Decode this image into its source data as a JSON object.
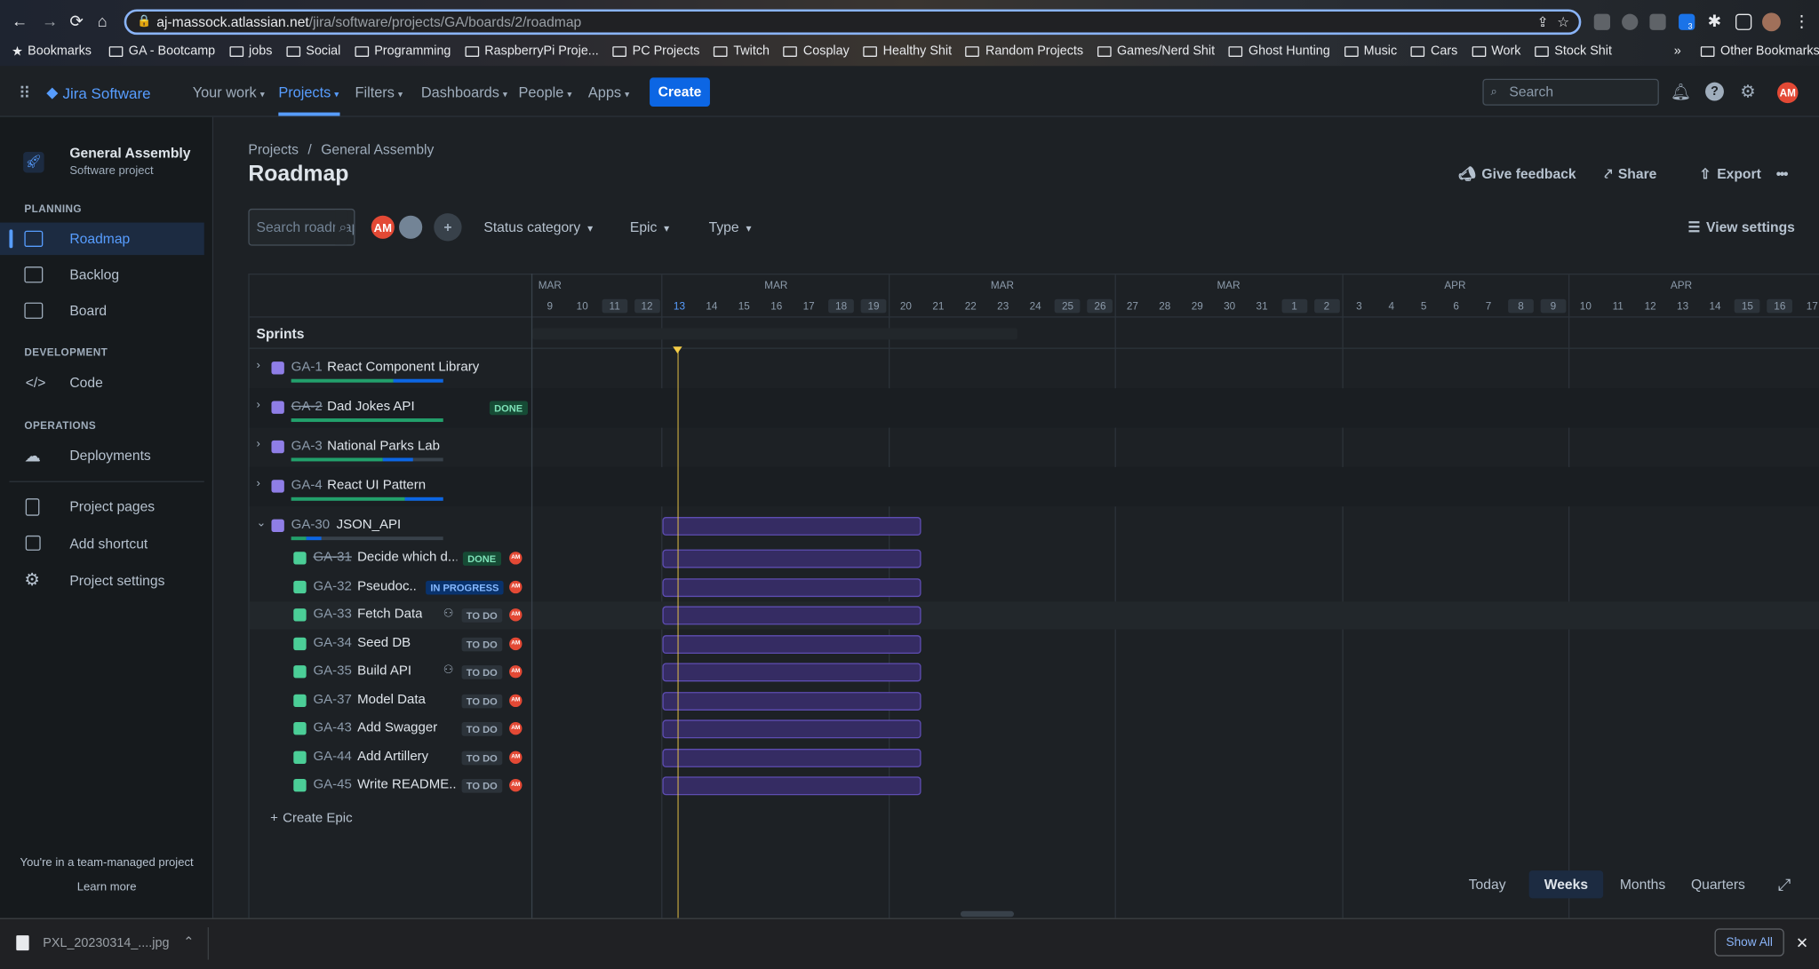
{
  "browser": {
    "url_host": "aj-massock.atlassian.net",
    "url_path": "/jira/software/projects/GA/boards/2/roadmap",
    "ext_badge": "3"
  },
  "bookmarks": [
    "Bookmarks",
    "GA - Bootcamp",
    "jobs",
    "Social",
    "Programming",
    "RaspberryPi Proje...",
    "PC Projects",
    "Twitch",
    "Cosplay",
    "Healthy Shit",
    "Random Projects",
    "Games/Nerd Shit",
    "Ghost Hunting",
    "Music",
    "Cars",
    "Work",
    "Stock Shit"
  ],
  "bookmarks_more": "»",
  "bookmarks_other": "Other Bookmarks",
  "topnav": {
    "logo": "Jira Software",
    "items": [
      "Your work",
      "Projects",
      "Filters",
      "Dashboards",
      "People",
      "Apps"
    ],
    "create": "Create",
    "search_placeholder": "Search",
    "avatar": "AM"
  },
  "project": {
    "name": "General Assembly",
    "type": "Software project"
  },
  "sidebar": {
    "planning": "PLANNING",
    "roadmap": "Roadmap",
    "backlog": "Backlog",
    "board": "Board",
    "development": "DEVELOPMENT",
    "code": "Code",
    "operations": "OPERATIONS",
    "deployments": "Deployments",
    "project_pages": "Project pages",
    "add_shortcut": "Add shortcut",
    "project_settings": "Project settings",
    "footer": "You're in a team-managed project",
    "learn_more": "Learn more"
  },
  "breadcrumb": {
    "projects": "Projects",
    "sep": "/",
    "project": "General Assembly"
  },
  "page_title": "Roadmap",
  "header_actions": {
    "feedback": "Give feedback",
    "share": "Share",
    "export": "Export",
    "more": "•••"
  },
  "filters": {
    "search_placeholder": "Search roadmap",
    "avatar1": "AM",
    "status": "Status category",
    "epic": "Epic",
    "type": "Type",
    "view_settings": "View settings"
  },
  "timeline": {
    "months": [
      {
        "label": "MAR"
      },
      {
        "label": "MAR"
      },
      {
        "label": "MAR"
      },
      {
        "label": "MAR"
      },
      {
        "label": "APR"
      },
      {
        "label": "APR"
      }
    ],
    "days": [
      "9",
      "10",
      "11",
      "12",
      "13",
      "14",
      "15",
      "16",
      "17",
      "18",
      "19",
      "20",
      "21",
      "22",
      "23",
      "24",
      "25",
      "26",
      "27",
      "28",
      "29",
      "30",
      "31",
      "1",
      "2",
      "3",
      "4",
      "5",
      "6",
      "7",
      "8",
      "9",
      "10",
      "11",
      "12",
      "13",
      "14",
      "15",
      "16",
      "17"
    ],
    "weekend_days": [
      "11",
      "12",
      "18",
      "19",
      "25",
      "26",
      "1",
      "2",
      "8",
      "9",
      "15",
      "16"
    ],
    "today": "13",
    "sprints_label": "Sprints"
  },
  "epics": [
    {
      "key": "GA-1",
      "summary": "React Component Library",
      "status": "",
      "strike": false,
      "progress_done": 0.67,
      "progress_inprog": 0.33
    },
    {
      "key": "GA-2",
      "summary": "Dad Jokes API",
      "status": "DONE",
      "strike": true,
      "progress_done": 1.0,
      "progress_inprog": 0
    },
    {
      "key": "GA-3",
      "summary": "National Parks Lab",
      "status": "",
      "strike": false,
      "progress_done": 0.6,
      "progress_inprog": 0.2
    },
    {
      "key": "GA-4",
      "summary": "React UI Pattern",
      "status": "",
      "strike": false,
      "progress_done": 0.75,
      "progress_inprog": 0.25
    },
    {
      "key": "GA-30",
      "summary": "JSON_API",
      "status": "",
      "strike": false,
      "progress_done": 0.1,
      "progress_inprog": 0.1
    }
  ],
  "issues": [
    {
      "key": "GA-31",
      "summary": "Decide which d...",
      "status": "DONE",
      "strike": true,
      "child": false
    },
    {
      "key": "GA-32",
      "summary": "Pseudoc...",
      "status": "IN PROGRESS",
      "strike": false,
      "child": false
    },
    {
      "key": "GA-33",
      "summary": "Fetch Data",
      "status": "TO DO",
      "strike": false,
      "child": true
    },
    {
      "key": "GA-34",
      "summary": "Seed DB",
      "status": "TO DO",
      "strike": false,
      "child": false
    },
    {
      "key": "GA-35",
      "summary": "Build API",
      "status": "TO DO",
      "strike": false,
      "child": true
    },
    {
      "key": "GA-37",
      "summary": "Model Data",
      "status": "TO DO",
      "strike": false,
      "child": false
    },
    {
      "key": "GA-43",
      "summary": "Add Swagger",
      "status": "TO DO",
      "strike": false,
      "child": false
    },
    {
      "key": "GA-44",
      "summary": "Add Artillery",
      "status": "TO DO",
      "strike": false,
      "child": false
    },
    {
      "key": "GA-45",
      "summary": "Write README....",
      "status": "TO DO",
      "strike": false,
      "child": false
    }
  ],
  "assignee_avatar": "AM",
  "create_epic": "Create Epic",
  "zoom": {
    "today": "Today",
    "weeks": "Weeks",
    "months": "Months",
    "quarters": "Quarters",
    "selected": "Weeks"
  },
  "download": {
    "file": "PXL_20230314_....jpg",
    "show_all": "Show All"
  }
}
